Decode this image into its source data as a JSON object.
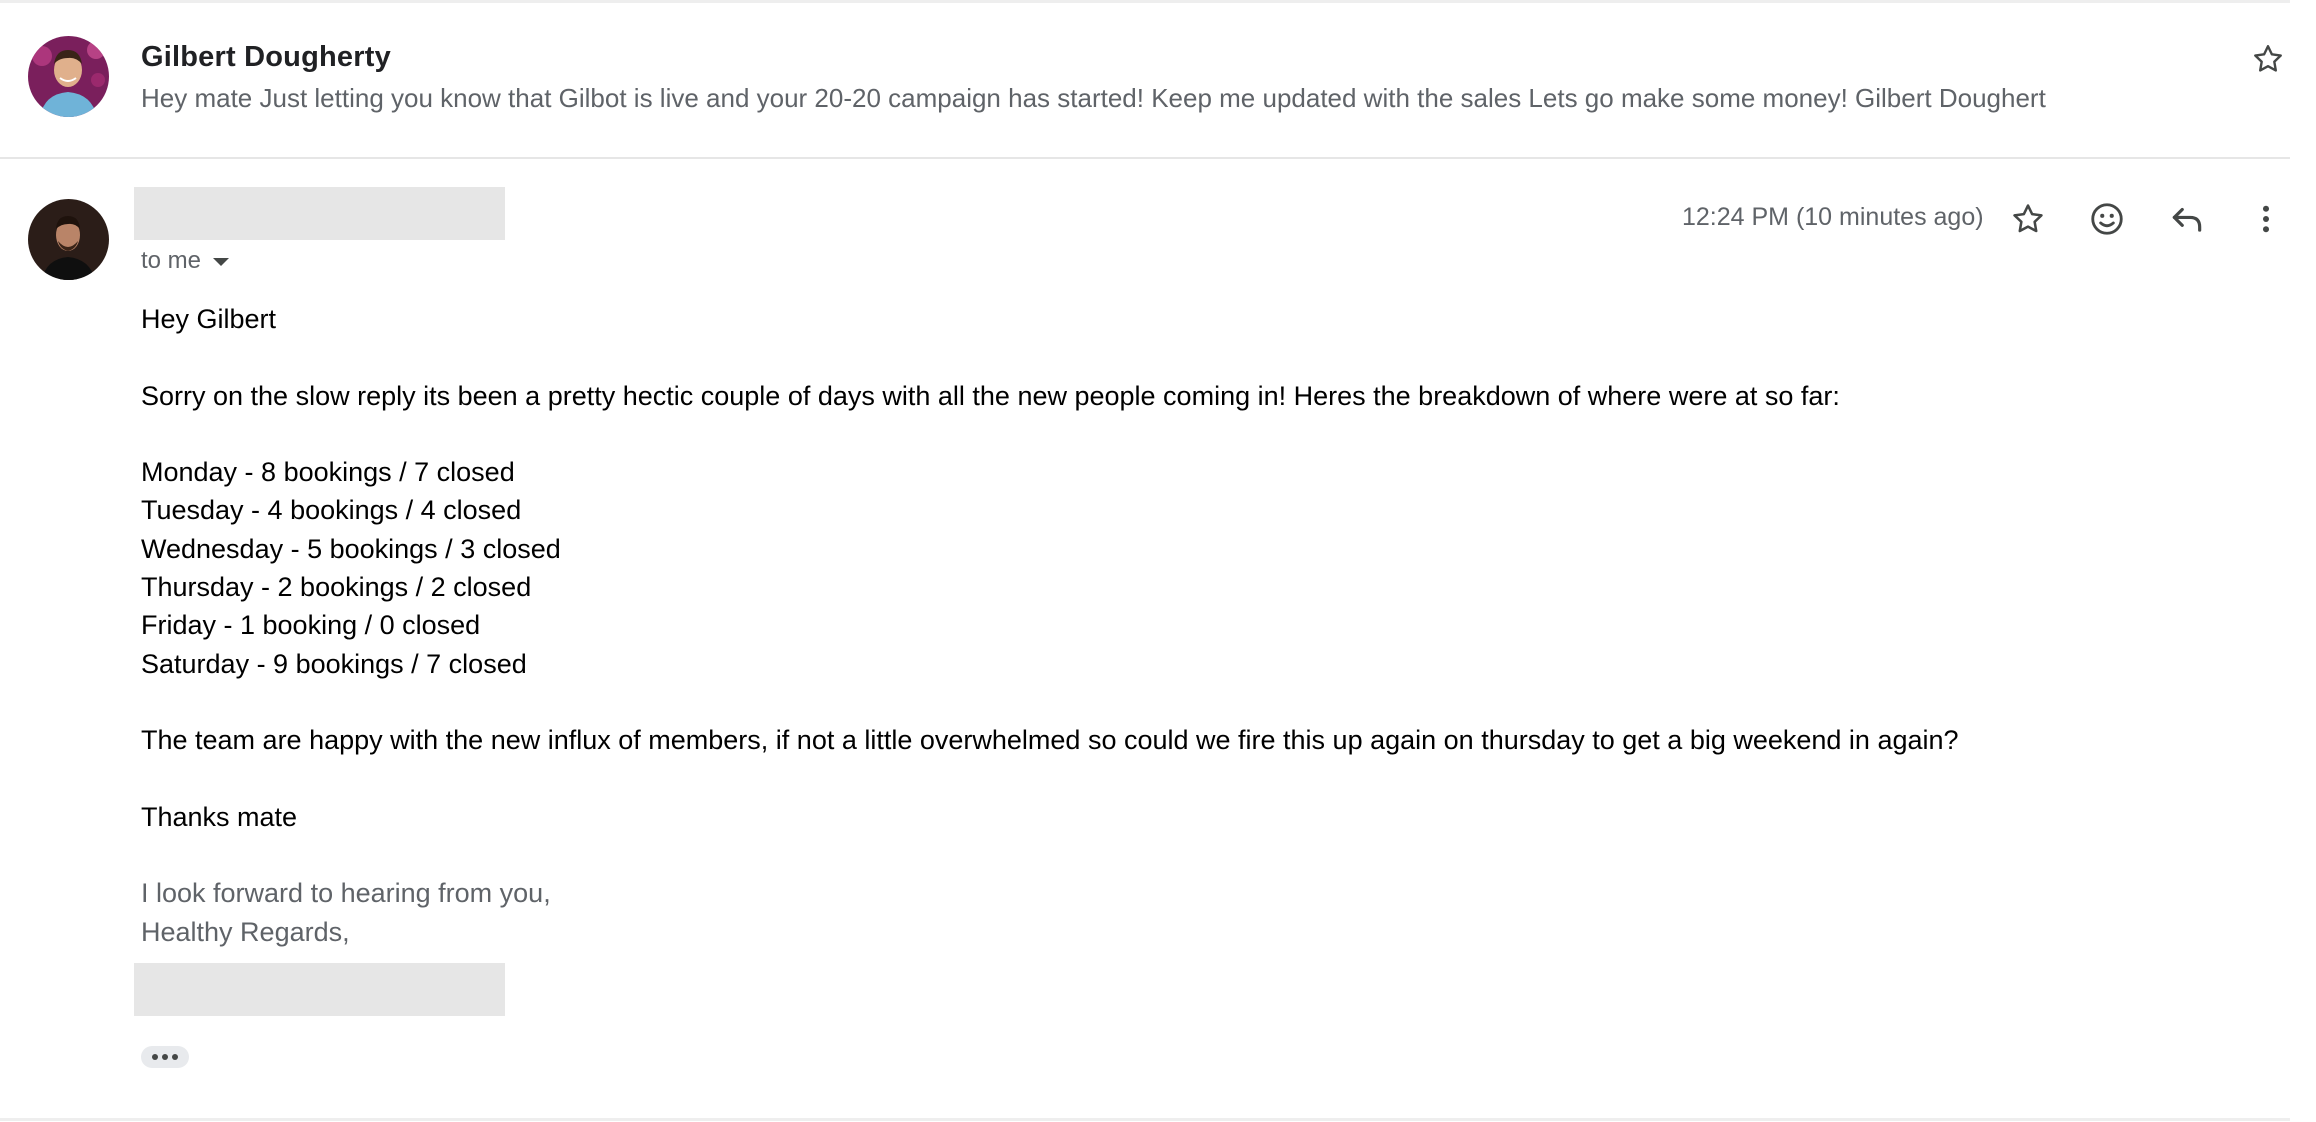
{
  "collapsed_message": {
    "sender": "Gilbert Dougherty",
    "snippet": "Hey mate Just letting you know that Gilbot is live and your 20-20 campaign has started! Keep me updated with the sales Lets go make some money! Gilbert Doughert"
  },
  "expanded_message": {
    "recipient_label": "to me",
    "timestamp": "12:24 PM (10 minutes ago)",
    "body": {
      "greeting": "Hey Gilbert",
      "intro": "Sorry on the slow reply its been a pretty hectic couple of days with all the new people coming in! Heres the breakdown of where were at so far:",
      "breakdown": [
        "Monday - 8 bookings / 7 closed",
        "Tuesday - 4 bookings / 4 closed",
        "Wednesday - 5 bookings / 3 closed",
        "Thursday - 2 bookings / 2 closed",
        "Friday - 1 booking / 0 closed",
        "Saturday - 9 bookings / 7 closed"
      ],
      "request": "The team are happy with the new influx of members, if not a little overwhelmed so could we fire this up again on thursday to get a big weekend in again?",
      "thanks": "Thanks mate",
      "signature": [
        "I look forward to hearing from you,",
        "Healthy Regards,"
      ]
    }
  },
  "icons": {
    "star": "star-icon",
    "emoji": "emoji-icon",
    "reply": "reply-icon",
    "more": "more-vert-icon",
    "trimmed_content": "more-horiz-icon"
  },
  "colors": {
    "secondary_text": "#5f6368",
    "redaction": "#e6e6e6",
    "icon": "#444746"
  }
}
